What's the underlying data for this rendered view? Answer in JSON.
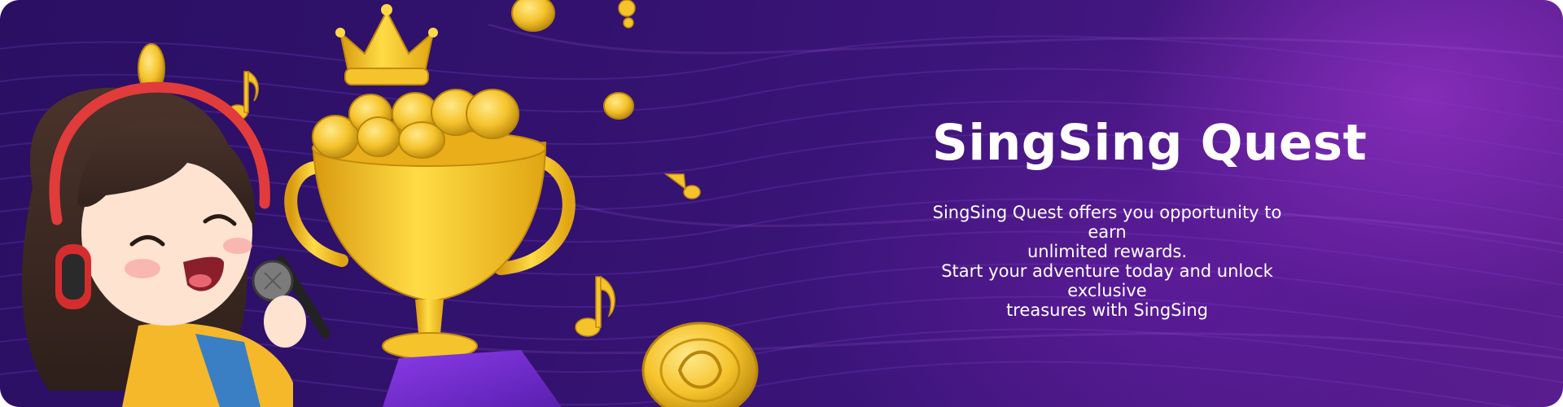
{
  "banner": {
    "title": "SingSing Quest",
    "description_lines": [
      "SingSing Quest offers you opportunity to earn",
      "unlimited rewards.",
      "Start your adventure today and unlock exclusive",
      "treasures with SingSing"
    ]
  },
  "colors": {
    "background_dark": "#2a0f63",
    "background_glow": "#9632c8",
    "gold": "#f5c32c",
    "text": "#ffffff"
  },
  "illustration": {
    "character": "girl-singer-with-headphones-and-microphone",
    "trophy": "gold-trophy-filled-with-coins",
    "crown": "gold-crown",
    "coin": "singsing-coin",
    "note": "music-note-icon"
  }
}
